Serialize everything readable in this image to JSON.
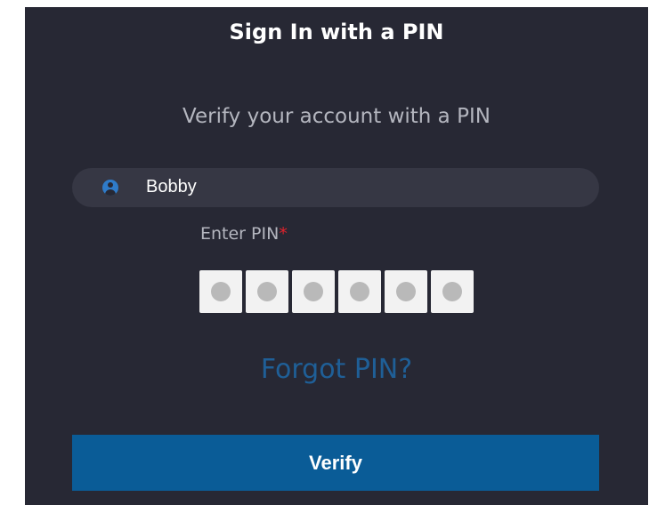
{
  "header": {
    "title": "Sign In with a PIN"
  },
  "subtitle": "Verify your account with a PIN",
  "user": {
    "name": "Bobby",
    "icon": "user-circle-icon"
  },
  "pin": {
    "label": "Enter PIN",
    "required_marker": "*",
    "digits": 6
  },
  "links": {
    "forgot": "Forgot PIN?"
  },
  "actions": {
    "verify_label": "Verify"
  },
  "colors": {
    "panel_bg": "#272834",
    "accent": "#0a5c97",
    "link": "#1f5f97",
    "required": "#e2222c",
    "user_icon": "#2f7bc9"
  }
}
